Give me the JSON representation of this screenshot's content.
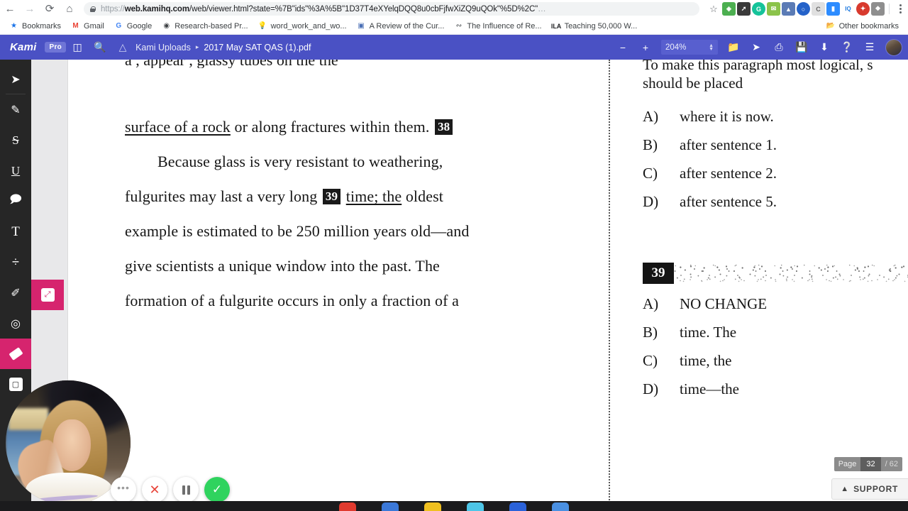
{
  "browser": {
    "nav": {
      "back_icon": "arrow-left-icon",
      "forward_icon": "arrow-right-icon",
      "reload_icon": "reload-icon",
      "home_icon": "home-icon"
    },
    "omnibox": {
      "lock_icon": "lock-icon",
      "scheme": "https://",
      "domain": "web.kamihq.com",
      "path": "/web/viewer.html?state=%7B\"ids\"%3A%5B\"1D37T4eXYelqDQQ8u0cbFjfwXiZQ9uQOk\"%5D%2C\"",
      "ellipsis": "…",
      "full_url": "https://web.kamihq.com/web/viewer.html?state=%7B\"ids\"%3A%5B\"1D37T4eXYelqDQQ8u0cbFjfwXiZQ9uQOk\"%5D%2C\"…"
    },
    "star_icon": "bookmark-star-icon",
    "menu_icon": "kebab-menu-icon",
    "extensions": [
      {
        "name": "evernote-extension-icon",
        "color": "#4caf50",
        "glyph": ""
      },
      {
        "name": "rocket-extension-icon",
        "color": "#3a3a3a",
        "glyph": ""
      },
      {
        "name": "grammarly-extension-icon",
        "color": "#15c39a",
        "glyph": "G"
      },
      {
        "name": "mail-extension-icon",
        "color": "#8bc34a",
        "glyph": ""
      },
      {
        "name": "mountain-extension-icon",
        "color": "#5b7bb5",
        "glyph": ""
      },
      {
        "name": "loom-extension-icon",
        "color": "#2462c9",
        "glyph": ""
      },
      {
        "name": "c-extension-icon",
        "color": "#9e9e9e",
        "glyph": "C"
      },
      {
        "name": "zoom-extension-icon",
        "color": "#2d8cff",
        "glyph": ""
      },
      {
        "name": "iq-extension-icon",
        "color": "#1f7ae0",
        "glyph": "IQ"
      },
      {
        "name": "red-circle-extension-icon",
        "color": "#d83a2e",
        "glyph": ""
      },
      {
        "name": "gray-extension-icon",
        "color": "#8e8e8e",
        "glyph": ""
      }
    ],
    "bookmarks": [
      {
        "label": "Bookmarks",
        "icon": "star-icon",
        "color": "#1a73e8",
        "glyph": "★"
      },
      {
        "label": "Gmail",
        "icon": "gmail-icon",
        "color": "#ea4335",
        "glyph": "M"
      },
      {
        "label": "Google",
        "icon": "google-icon",
        "color": "#4285f4",
        "glyph": "G"
      },
      {
        "label": "Research-based Pr...",
        "icon": "globe-icon",
        "color": "#3c4043",
        "glyph": "●"
      },
      {
        "label": "word_work_and_wo...",
        "icon": "lightbulb-icon",
        "color": "#9aa0a6",
        "glyph": "○"
      },
      {
        "label": "A Review of the Cur...",
        "icon": "document-icon",
        "color": "#4a6fb5",
        "glyph": "▣"
      },
      {
        "label": "The Influence of Re...",
        "icon": "chain-icon",
        "color": "#3c4043",
        "glyph": "∿"
      },
      {
        "label": "Teaching 50,000 W...",
        "icon": "ila-icon",
        "color": "#202124",
        "glyph": "ILA"
      }
    ],
    "other_bookmarks": {
      "label": "Other bookmarks",
      "icon": "folder-icon",
      "glyph": "▰"
    }
  },
  "kami": {
    "logo": "Kami",
    "pro_badge": "Pro",
    "sidebar_toggle_icon": "panel-toggle-icon",
    "search_icon": "search-icon",
    "drive_icon": "google-drive-icon",
    "breadcrumb_folder": "Kami Uploads",
    "breadcrumb_arrow": "▸",
    "file_name": "2017 May SAT QAS (1).pdf",
    "zoom_out_icon": "minus-icon",
    "zoom_in_icon": "plus-icon",
    "zoom_value": "204%",
    "zoom_spinner_icon": "spinner-updown-icon",
    "actions": [
      {
        "name": "open-folder-button",
        "icon": "folder-open-icon"
      },
      {
        "name": "share-button",
        "icon": "share-icon"
      },
      {
        "name": "print-button",
        "icon": "printer-icon"
      },
      {
        "name": "save-button",
        "icon": "floppy-save-icon"
      },
      {
        "name": "download-button",
        "icon": "download-icon"
      },
      {
        "name": "help-button",
        "icon": "question-circle-icon"
      },
      {
        "name": "menu-button",
        "icon": "hamburger-menu-icon"
      }
    ],
    "avatar": "user-avatar"
  },
  "tools": [
    {
      "name": "select-tool",
      "icon": "cursor-arrow-icon",
      "glyph": "➤",
      "active": false
    },
    {
      "name": "highlight-tool",
      "icon": "highlighter-pen-icon",
      "glyph": "✎",
      "active": false
    },
    {
      "name": "strikethrough-tool",
      "icon": "strikethrough-icon",
      "glyph": "S",
      "active": false
    },
    {
      "name": "underline-tool",
      "icon": "underline-icon",
      "glyph": "U",
      "active": false
    },
    {
      "name": "comment-tool",
      "icon": "comment-bubble-icon",
      "glyph": "▭",
      "active": false
    },
    {
      "name": "text-tool",
      "icon": "text-t-icon",
      "glyph": "T",
      "active": false
    },
    {
      "name": "equation-tool",
      "icon": "divide-icon",
      "glyph": "÷",
      "active": false
    },
    {
      "name": "draw-tool",
      "icon": "paintbrush-icon",
      "glyph": "✐",
      "active": false
    },
    {
      "name": "shapes-tool",
      "icon": "shapes-icon",
      "glyph": "◖",
      "active": false
    },
    {
      "name": "eraser-tool",
      "icon": "eraser-icon",
      "glyph": "▰",
      "active": true
    },
    {
      "name": "insert-image-tool",
      "icon": "image-insert-icon",
      "glyph": "❑",
      "active": false
    }
  ],
  "tool_submenu": {
    "name": "erase-region-option",
    "icon": "erase-selection-icon"
  },
  "document": {
    "cut_top_line": "a        , appear                     , glassy tubes on the          the",
    "left_column": {
      "lines": [
        {
          "type": "mixed",
          "parts": [
            {
              "text": "surface of a rock",
              "underline": true
            },
            {
              "text": " or along fractures within them. ",
              "underline": false
            },
            {
              "text": "38",
              "badge": true
            }
          ]
        },
        {
          "type": "plain",
          "indent": true,
          "text": "Because glass is very resistant to weathering,"
        },
        {
          "type": "mixed",
          "parts": [
            {
              "text": "fulgurites may last a very long ",
              "underline": false
            },
            {
              "text": "39",
              "badge": true
            },
            {
              "text": " ",
              "underline": false
            },
            {
              "text": "time; the",
              "underline": true
            },
            {
              "text": " oldest",
              "underline": false
            }
          ]
        },
        {
          "type": "plain",
          "indent": false,
          "text": "example is estimated to be 250 million years old—and"
        },
        {
          "type": "plain",
          "indent": false,
          "text": "give scientists a unique window into the past. The"
        },
        {
          "type": "plain",
          "indent": false,
          "text": "formation of a fulgurite occurs in only a fraction of a"
        }
      ]
    },
    "right_column": {
      "question_38": {
        "stem_line_1": "To make this paragraph most logical, s",
        "stem_line_2": "should be placed",
        "choices": [
          {
            "letter": "A)",
            "text": "where it is now."
          },
          {
            "letter": "B)",
            "text": "after sentence 1."
          },
          {
            "letter": "C)",
            "text": "after sentence 2."
          },
          {
            "letter": "D)",
            "text": "after sentence 5."
          }
        ]
      },
      "question_39": {
        "number": "39",
        "choices": [
          {
            "letter": "A)",
            "text": "NO CHANGE"
          },
          {
            "letter": "B)",
            "text": "time. The"
          },
          {
            "letter": "C)",
            "text": "time, the"
          },
          {
            "letter": "D)",
            "text": "time—the"
          }
        ]
      }
    }
  },
  "page_indicator": {
    "label": "Page",
    "current": "32",
    "total": "/ 62"
  },
  "support": {
    "caret_icon": "chevron-up-icon",
    "label": "SUPPORT"
  },
  "recorder": {
    "camera": "webcam-preview",
    "controls": [
      {
        "name": "more-options-button",
        "icon": "ellipsis-icon",
        "glyph": "•••"
      },
      {
        "name": "cancel-recording-button",
        "icon": "close-x-icon",
        "glyph": "✕"
      },
      {
        "name": "pause-recording-button",
        "icon": "pause-icon",
        "glyph": ""
      },
      {
        "name": "finish-recording-button",
        "icon": "checkmark-icon",
        "glyph": "✓"
      }
    ]
  },
  "taskbar": {
    "apps": [
      {
        "name": "taskbar-app-red",
        "color": "#e03a2f"
      },
      {
        "name": "taskbar-app-blue",
        "color": "#3b78d8"
      },
      {
        "name": "taskbar-app-yellow",
        "color": "#f0c020"
      },
      {
        "name": "taskbar-app-cyan",
        "color": "#4ec6e8"
      },
      {
        "name": "taskbar-app-indigo",
        "color": "#2b62d9"
      },
      {
        "name": "taskbar-app-lightblue",
        "color": "#4a90e2"
      }
    ]
  },
  "colors": {
    "kami_purple": "#4a51c4",
    "accent_pink": "#d6246e",
    "rail_dark": "#262626",
    "green": "#2fd35e"
  }
}
